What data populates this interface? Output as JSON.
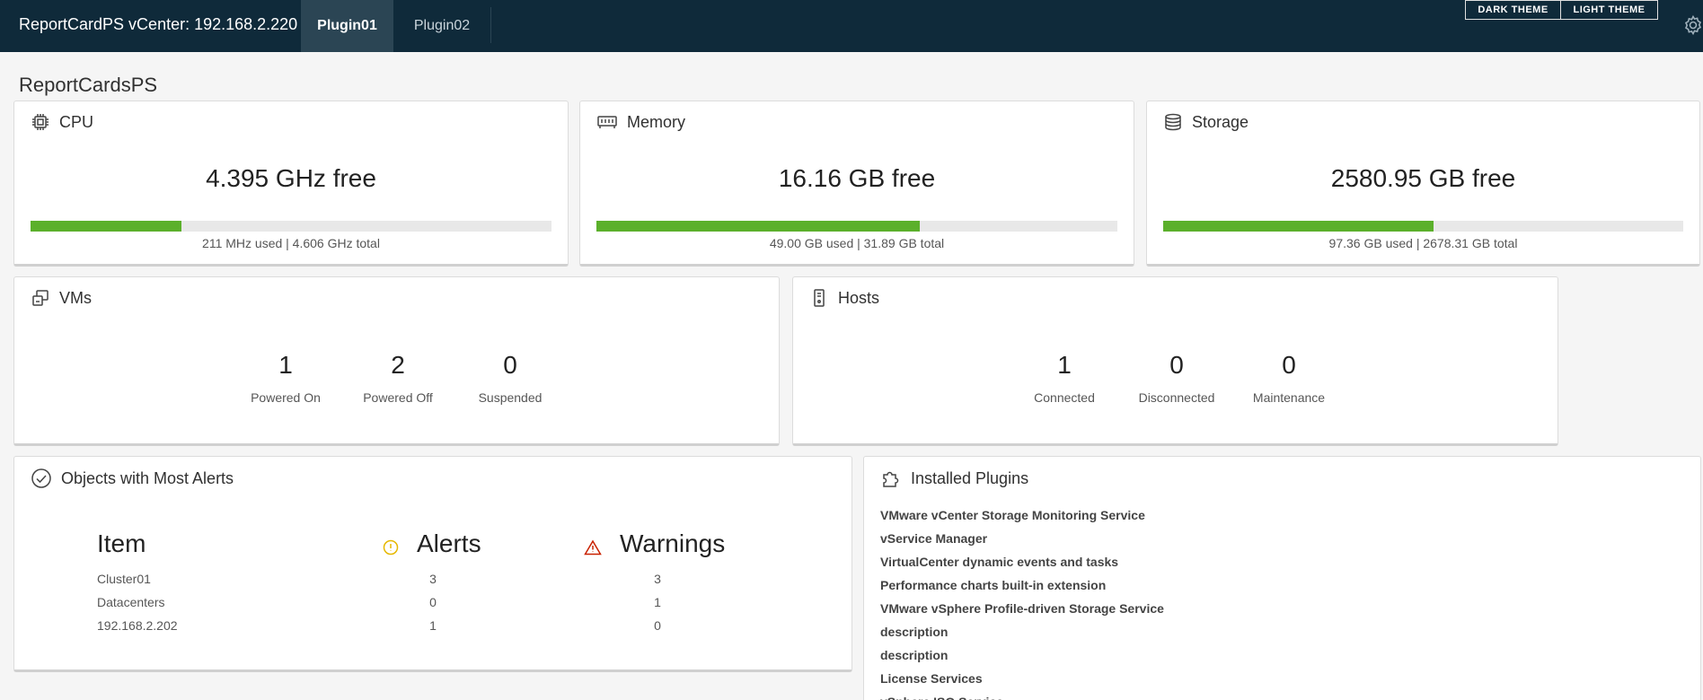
{
  "header": {
    "title": "ReportCardPS vCenter: 192.168.2.220",
    "tabs": [
      {
        "label": "Plugin01",
        "active": true
      },
      {
        "label": "Plugin02",
        "active": false
      }
    ],
    "dark_theme": "DARK THEME",
    "light_theme": "LIGHT THEME",
    "settings_icon": "gear-icon"
  },
  "page_title": "ReportCardsPS",
  "cpu": {
    "title": "CPU",
    "icon": "cpu-icon",
    "free": "4.395 GHz free",
    "usage": "211 MHz used | 4.606 GHz total",
    "fill_fraction": 0.29
  },
  "memory": {
    "title": "Memory",
    "icon": "memory-icon",
    "free": "16.16 GB free",
    "usage": "49.00 GB used | 31.89 GB total",
    "fill_fraction": 0.62
  },
  "storage": {
    "title": "Storage",
    "icon": "storage-icon",
    "free": "2580.95 GB free",
    "usage": "97.36 GB used | 2678.31 GB total",
    "fill_fraction": 0.52
  },
  "vms": {
    "title": "VMs",
    "icon": "vm-icon",
    "stats": [
      {
        "value": "1",
        "label": "Powered On"
      },
      {
        "value": "2",
        "label": "Powered Off"
      },
      {
        "value": "0",
        "label": "Suspended"
      }
    ]
  },
  "hosts": {
    "title": "Hosts",
    "icon": "host-icon",
    "stats": [
      {
        "value": "1",
        "label": "Connected"
      },
      {
        "value": "0",
        "label": "Disconnected"
      },
      {
        "value": "0",
        "label": "Maintenance"
      }
    ]
  },
  "alerts": {
    "title": "Objects with Most Alerts",
    "icon": "check-circle-icon",
    "headers": {
      "item": "Item",
      "alerts": "Alerts",
      "warnings": "Warnings"
    },
    "rows": [
      {
        "item": "Cluster01",
        "alerts": "3",
        "warnings": "3"
      },
      {
        "item": "Datacenters",
        "alerts": "0",
        "warnings": "1"
      },
      {
        "item": "192.168.2.202",
        "alerts": "1",
        "warnings": "0"
      }
    ],
    "colors": {
      "alert": "#e6b800",
      "warning": "#c92100"
    }
  },
  "plugins": {
    "title": "Installed Plugins",
    "icon": "puzzle-icon",
    "items": [
      "VMware vCenter Storage Monitoring Service",
      "vService Manager",
      "VirtualCenter dynamic events and tasks",
      "Performance charts built-in extension",
      "VMware vSphere Profile-driven Storage Service",
      "description",
      "description",
      "License Services",
      "vSphere ISO Service"
    ]
  },
  "colors": {
    "header_bg": "#0f2a3a",
    "active_tab": "#2b4554",
    "bar_fill": "#5bb02b"
  }
}
